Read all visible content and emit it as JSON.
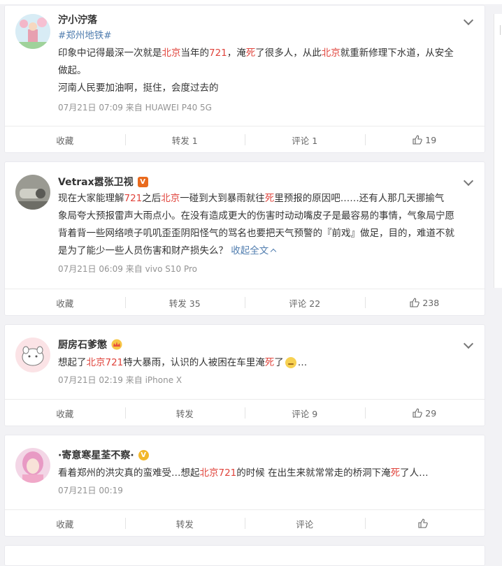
{
  "posts": [
    {
      "user": "泞小泞落",
      "badge": "",
      "hashtag": "#郑州地铁#",
      "lines": [
        [
          {
            "t": "印象中记得最深一次就是"
          },
          {
            "t": "北京",
            "c": "red"
          },
          {
            "t": "当年的"
          },
          {
            "t": "721",
            "c": "red"
          },
          {
            "t": "，淹"
          },
          {
            "t": "死",
            "c": "red"
          },
          {
            "t": "了很多人，从此"
          },
          {
            "t": "北京",
            "c": "red"
          },
          {
            "t": "就重新修理下水道，从安全"
          }
        ],
        [
          {
            "t": "做起。"
          }
        ],
        [
          {
            "t": "河南人民要加油啊，挺住，会度过去的"
          }
        ]
      ],
      "meta": "07月21日 07:09  来自 HUAWEI P40 5G",
      "actions": {
        "fav": "收藏",
        "repost": "转发 1",
        "comment": "评论 1",
        "like": "19"
      }
    },
    {
      "user": "Vetrax嚣张卫视",
      "badge": "V",
      "lines": [
        [
          {
            "t": "现在大家能理解"
          },
          {
            "t": "721",
            "c": "red"
          },
          {
            "t": "之后"
          },
          {
            "t": "北京",
            "c": "red"
          },
          {
            "t": "一碰到大到暴雨就往"
          },
          {
            "t": "死",
            "c": "red"
          },
          {
            "t": "里预报的原因吧……还有人那几天挪揄气"
          }
        ],
        [
          {
            "t": "象局夸大预报雷声大雨点小。在没有造成更大的伤害时动动嘴皮子是最容易的事情，气象局宁愿"
          }
        ],
        [
          {
            "t": "背着背一些网络喷子叽叽歪歪阴阳怪气的骂名也要把天气预警的『前戏』做足，目的，难道不就"
          }
        ],
        [
          {
            "t": "是为了能少一些人员伤害和财产损失么？ "
          },
          {
            "t": "收起全文",
            "c": "blue"
          }
        ]
      ],
      "meta": "07月21日 06:09  来自 vivo S10 Pro",
      "actions": {
        "fav": "收藏",
        "repost": "转发 35",
        "comment": "评论 22",
        "like": "238"
      }
    },
    {
      "user": "厨房石爹懲",
      "badge": "crown",
      "lines": [
        [
          {
            "t": "想起了"
          },
          {
            "t": "北京721",
            "c": "red"
          },
          {
            "t": "特大暴雨，认识的人被困在车里淹"
          },
          {
            "t": "死",
            "c": "red"
          },
          {
            "t": "了"
          },
          {
            "t": "EMOJI"
          },
          {
            "t": "…"
          }
        ]
      ],
      "meta": "07月21日 02:19  来自 iPhone X",
      "actions": {
        "fav": "收藏",
        "repost": "转发",
        "comment": "评论 9",
        "like": "29"
      }
    },
    {
      "user": "·寄意寒星荃不察·",
      "badge": "gold",
      "lines": [
        [
          {
            "t": "看着郑州的洪灾真的蛮难受…想起"
          },
          {
            "t": "北京721",
            "c": "red"
          },
          {
            "t": "的时候 在出生来就常常走的桥洞下淹"
          },
          {
            "t": "死",
            "c": "red"
          },
          {
            "t": "了人…"
          }
        ]
      ],
      "meta": "07月21日 00:19",
      "actions": {
        "fav": "收藏",
        "repost": "转发",
        "comment": "评论",
        "like": ""
      }
    }
  ],
  "colors": {
    "highlight": "#e0443c",
    "link": "#eb7350",
    "blueLink": "#507daf",
    "meta": "#939393"
  }
}
